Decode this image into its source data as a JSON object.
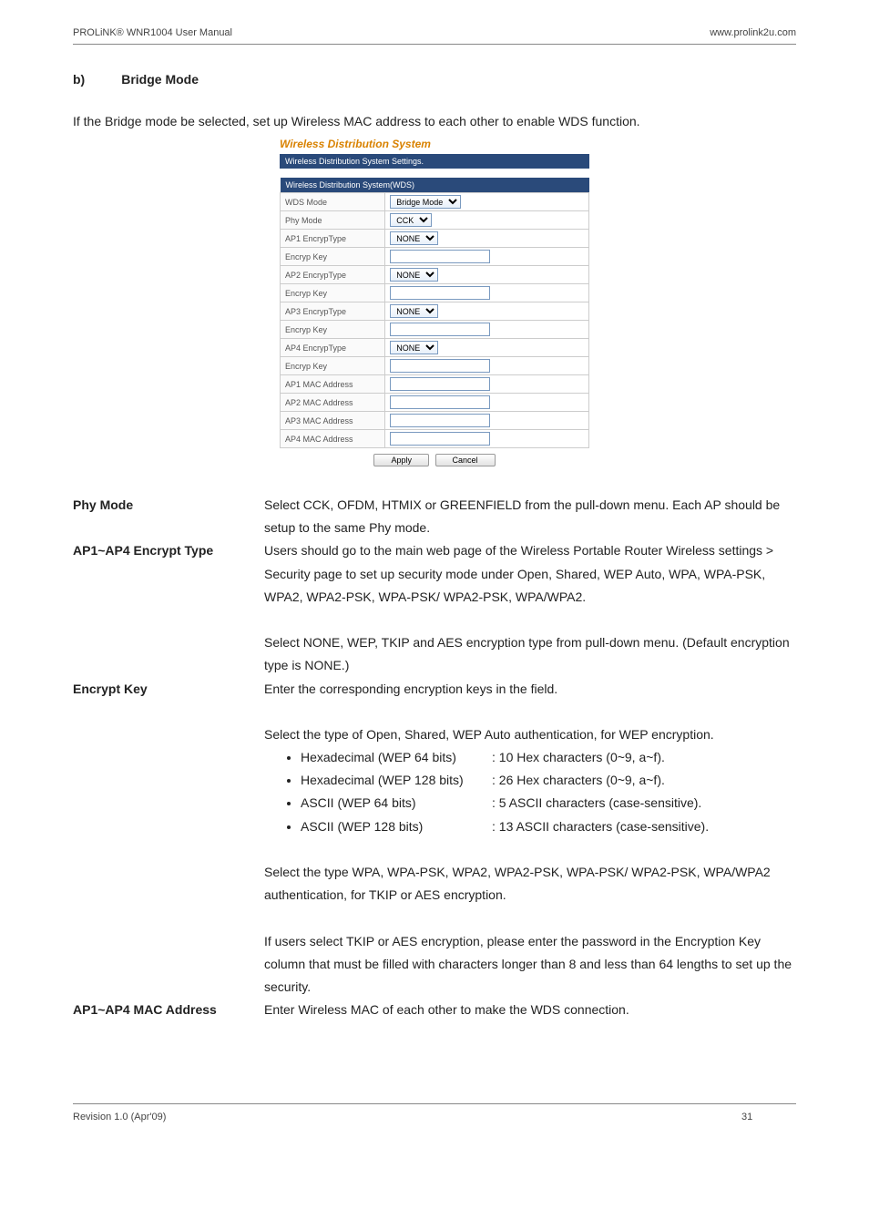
{
  "header": {
    "left": "PROLiNK® WNR1004 User Manual",
    "right": "www.prolink2u.com"
  },
  "section": {
    "letter": "b)",
    "title": "Bridge Mode"
  },
  "intro": "If the Bridge mode be selected, set up Wireless MAC address to each other to enable WDS function.",
  "screenshot": {
    "title": "Wireless Distribution System",
    "subbar": "Wireless Distribution System Settings.",
    "group_header": "Wireless Distribution System(WDS)",
    "rows": {
      "wds_mode": {
        "label": "WDS Mode",
        "value": "Bridge Mode"
      },
      "phy_mode": {
        "label": "Phy Mode",
        "value": "CCK"
      },
      "ap1e": {
        "label": "AP1 EncrypType",
        "value": "NONE"
      },
      "ek1": {
        "label": "Encryp Key",
        "value": ""
      },
      "ap2e": {
        "label": "AP2 EncrypType",
        "value": "NONE"
      },
      "ek2": {
        "label": "Encryp Key",
        "value": ""
      },
      "ap3e": {
        "label": "AP3 EncrypType",
        "value": "NONE"
      },
      "ek3": {
        "label": "Encryp Key",
        "value": ""
      },
      "ap4e": {
        "label": "AP4 EncrypType",
        "value": "NONE"
      },
      "ek4": {
        "label": "Encryp Key",
        "value": ""
      },
      "m1": {
        "label": "AP1 MAC Address",
        "value": ""
      },
      "m2": {
        "label": "AP2 MAC Address",
        "value": ""
      },
      "m3": {
        "label": "AP3 MAC Address",
        "value": ""
      },
      "m4": {
        "label": "AP4 MAC Address",
        "value": ""
      }
    },
    "buttons": {
      "apply": "Apply",
      "cancel": "Cancel"
    }
  },
  "defs": {
    "phy_mode": {
      "term": "Phy Mode",
      "body1": "Select CCK, OFDM, HTMIX or GREENFIELD from the pull-down menu. Each AP should be setup to the same Phy mode."
    },
    "encrypt_type": {
      "term": "AP1~AP4 Encrypt Type",
      "body1": "Users should go to the main web page of the Wireless Portable Router Wireless settings > Security page to set up security mode under Open, Shared, WEP Auto, WPA, WPA-PSK, WPA2, WPA2-PSK, WPA-PSK/ WPA2-PSK, WPA/WPA2.",
      "body2": "Select NONE, WEP, TKIP and AES encryption type from pull-down menu. (Default encryption type is NONE.)"
    },
    "encrypt_key": {
      "term": "Encrypt Key",
      "body1": "Enter the corresponding encryption keys in the field.",
      "body2": "Select the type of Open, Shared, WEP Auto authentication, for WEP encryption.",
      "wep": [
        {
          "l": "Hexadecimal (WEP 64 bits)",
          "r": ": 10 Hex characters (0~9, a~f)."
        },
        {
          "l": "Hexadecimal (WEP 128 bits)",
          "r": ": 26 Hex characters (0~9, a~f)."
        },
        {
          "l": "ASCII (WEP 64 bits)",
          "r": ": 5 ASCII characters (case-sensitive)."
        },
        {
          "l": "ASCII (WEP 128 bits)",
          "r": ": 13 ASCII characters (case-sensitive)."
        }
      ],
      "body3": "Select the type WPA, WPA-PSK, WPA2, WPA2-PSK, WPA-PSK/ WPA2-PSK, WPA/WPA2 authentication, for  TKIP or AES encryption.",
      "body4": "If users select TKIP or AES encryption, please enter the password in the Encryption Key column that must be filled with characters longer than 8 and less than 64 lengths to set up the security."
    },
    "mac": {
      "term": "AP1~AP4 MAC Address",
      "body1": "Enter Wireless MAC of each other to make the WDS connection."
    }
  },
  "footer": {
    "rev": "Revision 1.0 (Apr'09)",
    "page": "31"
  }
}
